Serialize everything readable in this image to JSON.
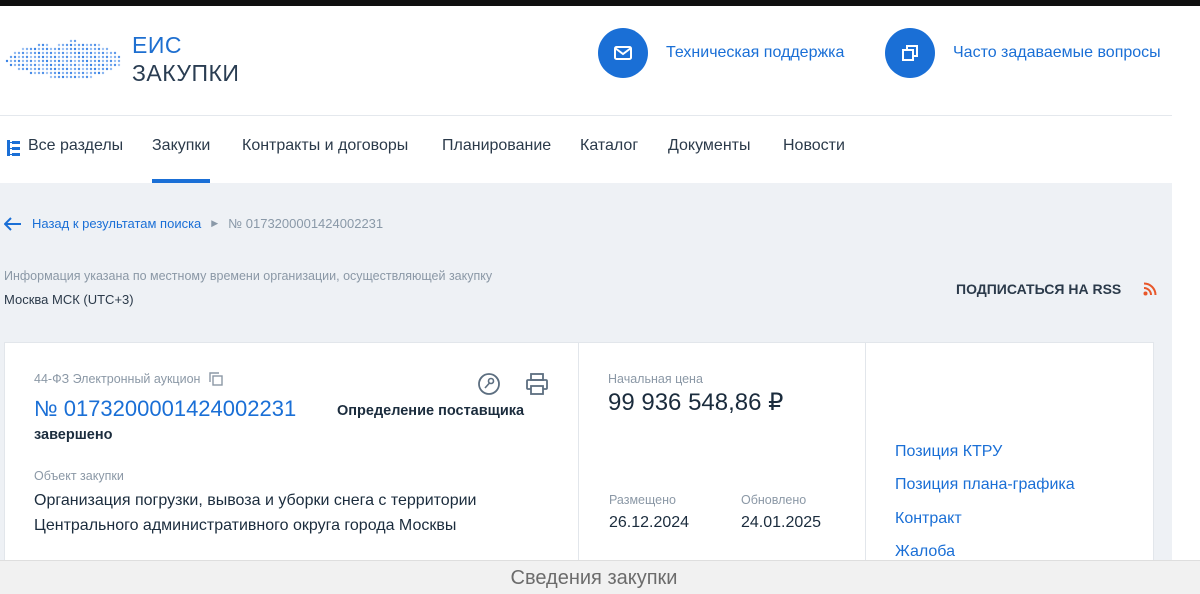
{
  "logo": {
    "line1": "ЕИС",
    "line2": "ЗАКУПКИ"
  },
  "header_links": [
    {
      "label": "Техническая поддержка",
      "icon": "mail-icon"
    },
    {
      "label": "Часто задаваемые вопросы",
      "icon": "windows-icon"
    }
  ],
  "nav": {
    "all_sections": "Все разделы",
    "items": [
      "Закупки",
      "Контракты и договоры",
      "Планирование",
      "Каталог",
      "Документы",
      "Новости"
    ],
    "active": "Закупки"
  },
  "breadcrumb": {
    "back": "Назад к результатам поиска",
    "current": "№ 0173200001424002231"
  },
  "timezone": {
    "info": "Информация указана по местному времени организации, осуществляющей закупку",
    "value": "Москва МСК (UTC+3)"
  },
  "rss": {
    "label": "ПОДПИСАТЬСЯ НА RSS"
  },
  "purchase": {
    "law_type": "44-ФЗ Электронный аукцион",
    "number": "№ 0173200001424002231",
    "status_line1": "Определение поставщика",
    "status_line2": "завершено",
    "object_label": "Объект закупки",
    "object_text": "Организация погрузки, вывоза и уборки снега с территории Центрального административного округа города Москвы",
    "price_label": "Начальная цена",
    "price": "99 936 548,86 ₽",
    "published_label": "Размещено",
    "published": "26.12.2024",
    "updated_label": "Обновлено",
    "updated": "24.01.2025"
  },
  "side_links": [
    "Позиция КТРУ",
    "Позиция плана-графика",
    "Контракт",
    "Жалоба"
  ],
  "bottom_caption": "Сведения закупки",
  "colors": {
    "accent": "#1a6fd6",
    "rss": "#e8572a",
    "page_bg": "#eef1f5"
  }
}
